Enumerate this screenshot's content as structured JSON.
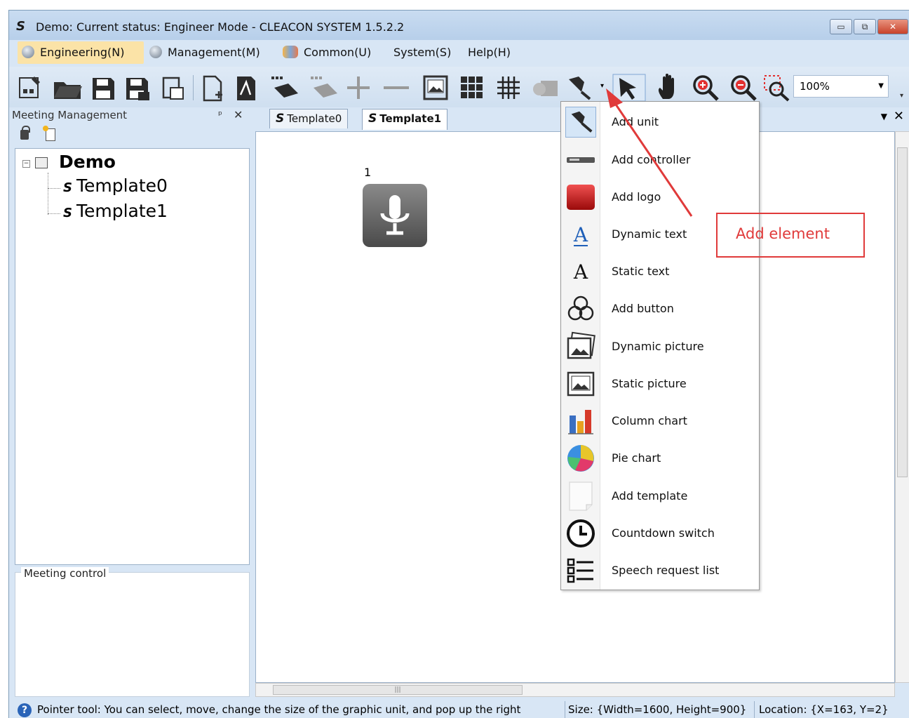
{
  "window": {
    "logo": "S",
    "title": "Demo: Current status: Engineer Mode - CLEACON SYSTEM 1.5.2.2",
    "controls": [
      "minimize",
      "restore",
      "close"
    ]
  },
  "menubar": {
    "items": [
      {
        "label": "Engineering(N)",
        "active": true
      },
      {
        "label": "Management(M)",
        "active": false
      },
      {
        "label": "Common(U)",
        "active": false
      },
      {
        "label": "System(S)",
        "active": false
      },
      {
        "label": "Help(H)",
        "active": false
      }
    ]
  },
  "toolbar": {
    "zoom_value": "100%"
  },
  "left_panel": {
    "title": "Meeting Management",
    "pin_glyph": "ᵖ",
    "close_glyph": "✕",
    "tree": {
      "root": "Demo",
      "children": [
        "Template0",
        "Template1"
      ]
    },
    "meeting_control_label": "Meeting control"
  },
  "tabs": {
    "items": [
      {
        "label": "Template0",
        "active": false
      },
      {
        "label": "Template1",
        "active": true
      }
    ]
  },
  "canvas": {
    "unit_number": "1"
  },
  "dropdown": {
    "items": [
      {
        "label": "Add unit",
        "icon": "microphone-icon"
      },
      {
        "label": "Add controller",
        "icon": "controller-icon"
      },
      {
        "label": "Add logo",
        "icon": "logo-icon"
      },
      {
        "label": "Dynamic text",
        "icon": "dynamic-text-icon"
      },
      {
        "label": "Static text",
        "icon": "static-text-icon"
      },
      {
        "label": "Add button",
        "icon": "button-icon"
      },
      {
        "label": "Dynamic picture",
        "icon": "dynamic-picture-icon"
      },
      {
        "label": "Static picture",
        "icon": "static-picture-icon"
      },
      {
        "label": "Column chart",
        "icon": "column-chart-icon"
      },
      {
        "label": "Pie chart",
        "icon": "pie-chart-icon"
      },
      {
        "label": "Add template",
        "icon": "template-icon"
      },
      {
        "label": "Countdown switch",
        "icon": "clock-icon"
      },
      {
        "label": "Speech request list",
        "icon": "list-icon"
      }
    ]
  },
  "annotation": {
    "callout_text": "Add element",
    "color": "#e03a3a"
  },
  "statusbar": {
    "hint": "Pointer tool: You can select, move, change the size of the graphic unit, and pop up the right",
    "size": "Size: {Width=1600, Height=900}",
    "location": "Location: {X=163, Y=2}"
  }
}
